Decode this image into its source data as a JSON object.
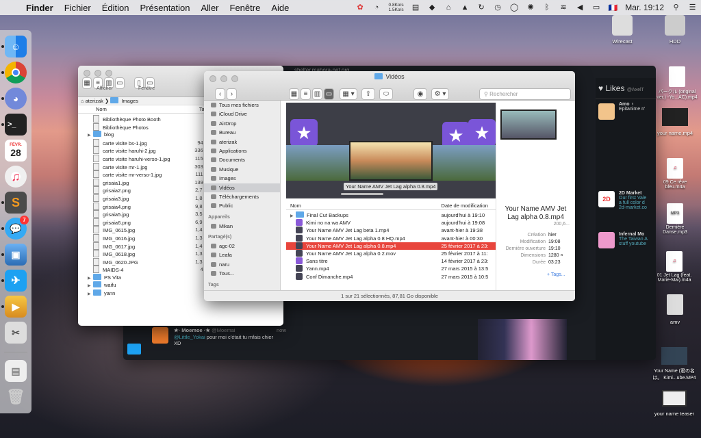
{
  "menubar": {
    "app": "Finder",
    "items": [
      "Fichier",
      "Édition",
      "Présentation",
      "Aller",
      "Fenêtre",
      "Aide"
    ],
    "net_up": "0.8Ko/s",
    "net_down": "1.5Ko/s",
    "clock": "Mar. 19:12",
    "flag": "🇫🇷"
  },
  "desktop": [
    {
      "label": "Wirecast"
    },
    {
      "label": "HDD"
    },
    {
      "label": "パークル (original\nver.) -Yo...AC).mp4"
    },
    {
      "label": "your name.mp4"
    },
    {
      "label": "09 Ce rêve\nbleu.m4a"
    },
    {
      "label": "Dernière\nDanse.mp3"
    },
    {
      "label": "01 Jet Lag (feat.\nMarie-Mai).m4a"
    },
    {
      "label": "amv"
    },
    {
      "label": "Your Name (君の名\nは。 Kimi...ube.MP4"
    },
    {
      "label": "your name teaser"
    }
  ],
  "dock_badge": "7",
  "calendar": {
    "month": "FÉVR.",
    "day": "28"
  },
  "twitter": {
    "likes_title": "Likes",
    "likes_handle": "@AxelT",
    "items": [
      {
        "name": "Amo ♀",
        "text": "Epitanime n'"
      },
      {
        "name": "2D Market",
        "text": "Our first Vale\na full color d\n2d-market.co"
      },
      {
        "name": "Infernal Mo",
        "text": "The Taiwan A\nstuff youtube"
      }
    ],
    "bottom_name": "★· Moemoe ·★",
    "bottom_handle": "@Moemai",
    "bottom_time": "now",
    "bottom_mention": "@Little_Yokai",
    "bottom_text": " pour moi c'était tu mfais chier\nXD",
    "url_bar": "shelter.mahora-net.org"
  },
  "images_window": {
    "toolbar": {
      "afficher": "Afficher",
      "fenetre": "Fenêtre"
    },
    "path": [
      "aterizak",
      "Images"
    ],
    "col_name": "Nom",
    "col_size": "Taille",
    "rows": [
      {
        "n": "Bibliothèque Photo Booth",
        "s": "--",
        "t": "file"
      },
      {
        "n": "Bibliothèque Photos",
        "s": "--",
        "t": "file"
      },
      {
        "n": "blog",
        "s": "--",
        "t": "folder"
      },
      {
        "n": "carte visite bs-1.jpg",
        "s": "94 Ko",
        "t": "file"
      },
      {
        "n": "carte visite haruhi-2.jpg",
        "s": "336 Ko",
        "t": "file"
      },
      {
        "n": "carte visite haruhi-verso-1.jpg",
        "s": "115 Ko",
        "t": "file"
      },
      {
        "n": "carte visite mr-1.jpg",
        "s": "303 Ko",
        "t": "file"
      },
      {
        "n": "carte visite mr-verso-1.jpg",
        "s": "111 Ko",
        "t": "file"
      },
      {
        "n": "grisaia1.jpg",
        "s": "139 Ko",
        "t": "file"
      },
      {
        "n": "grisaia2.png",
        "s": "2,7 Mo",
        "t": "file"
      },
      {
        "n": "grisaia3.jpg",
        "s": "1,8 Mo",
        "t": "file"
      },
      {
        "n": "grisaia4.png",
        "s": "9,8 Mo",
        "t": "file"
      },
      {
        "n": "grisaia5.jpg",
        "s": "3,5 Mo",
        "t": "file"
      },
      {
        "n": "grisaia6.png",
        "s": "6,9 Mo",
        "t": "file"
      },
      {
        "n": "IMG_0615.jpg",
        "s": "1,4 Mo",
        "t": "file"
      },
      {
        "n": "IMG_0616.jpg",
        "s": "1,3 Mo",
        "t": "file"
      },
      {
        "n": "IMG_0617.jpg",
        "s": "1,4 Mo",
        "t": "file"
      },
      {
        "n": "IMG_0618.jpg",
        "s": "1,3 Mo",
        "t": "file"
      },
      {
        "n": "IMG_0620.JPG",
        "s": "1,3 Mo",
        "t": "file"
      },
      {
        "n": "MAIDS-4",
        "s": "4 Ko",
        "t": "file"
      },
      {
        "n": "PS Vita",
        "s": "--",
        "t": "folder"
      },
      {
        "n": "waifu",
        "s": "--",
        "t": "folder"
      },
      {
        "n": "yann",
        "s": "--",
        "t": "folder"
      }
    ]
  },
  "videos_window": {
    "title": "Vidéos",
    "search_placeholder": "Rechercher",
    "sidebar": {
      "favoris": [
        "Tous mes fichiers",
        "iCloud Drive",
        "AirDrop",
        "Bureau",
        "aterizak",
        "Applications",
        "Documents",
        "Musique",
        "Images",
        "Vidéos",
        "Téléchargements",
        "Public"
      ],
      "appareils_title": "Appareils",
      "appareils": [
        "Mikan"
      ],
      "partages_title": "Partagé(s)",
      "partages": [
        "agc-02",
        "Leafa",
        "naru",
        "Tous..."
      ],
      "tags_title": "Tags"
    },
    "cover_label": "Your Name AMV Jet Lag alpha 0.8.mp4",
    "col_name": "Nom",
    "col_date": "Date de modification",
    "rows": [
      {
        "n": "Final Cut Backups",
        "d": "aujourd'hui à 19:10",
        "t": "folder"
      },
      {
        "n": "Kimi no na wa AMV",
        "d": "aujourd'hui à 19:08",
        "t": "imov"
      },
      {
        "n": "Your Name AMV Jet Lag beta 1.mp4",
        "d": "avant-hier à 19:38",
        "t": "vid"
      },
      {
        "n": "Your Name AMV Jet Lag alpha 0.8 HQ.mp4",
        "d": "avant-hier à 00:30",
        "t": "vid"
      },
      {
        "n": "Your Name AMV Jet Lag alpha 0.8.mp4",
        "d": "25 février 2017 à 23:",
        "t": "vid",
        "sel": true
      },
      {
        "n": "Your Name AMV Jet Lag alpha 0.2.mov",
        "d": "25 février 2017 à 11:",
        "t": "vid"
      },
      {
        "n": "Sans titre",
        "d": "14 février 2017 à 23:",
        "t": "imov"
      },
      {
        "n": "Yann.mp4",
        "d": "27 mars 2015 à 13:5",
        "t": "vid"
      },
      {
        "n": "Conf Dimanche.mp4",
        "d": "27 mars 2015 à 10:5",
        "t": "vid"
      }
    ],
    "preview": {
      "title": "Your Name AMV Jet Lag alpha 0.8.mp4",
      "size": "200,6...",
      "labels": [
        "Création",
        "Modification",
        "Dernière ouverture",
        "Dimensions",
        "Durée"
      ],
      "values": [
        "hier",
        "19:08",
        "19:10",
        "1280 ×",
        "03:23"
      ],
      "tags": "+ Tags..."
    },
    "status": "1 sur 21 sélectionnés, 87,81 Go disponible"
  }
}
